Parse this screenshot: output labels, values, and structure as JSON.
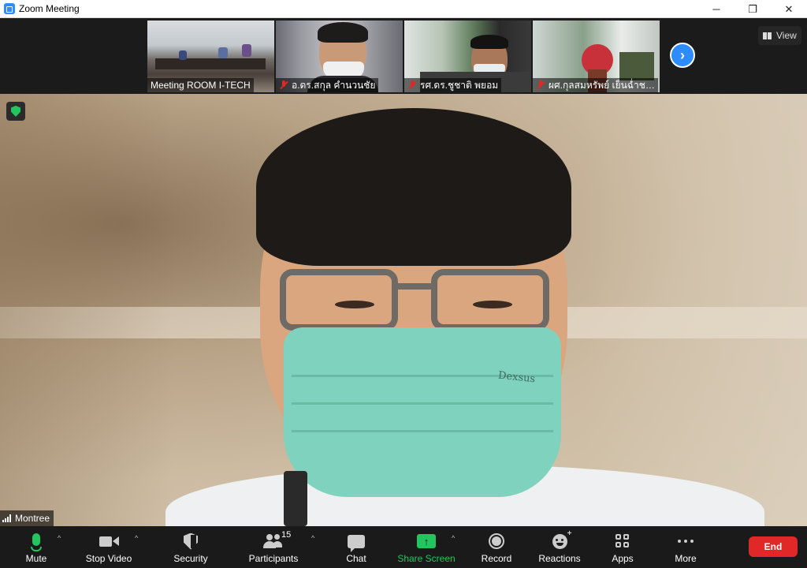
{
  "window": {
    "title": "Zoom Meeting",
    "minimize_glyph": "─",
    "maximize_glyph": "❐",
    "close_glyph": "✕"
  },
  "thumbnails": [
    {
      "label": "Meeting ROOM I-TECH",
      "muted": false
    },
    {
      "label": "อ.ดร.สกุล  คำนวนชัย",
      "muted": true
    },
    {
      "label": "รศ.ดร.ชูชาติ  พยอม",
      "muted": true
    },
    {
      "label": "ผศ.กุลสมหรัพย์  เย็นฉ่ำช…",
      "muted": true
    }
  ],
  "strip": {
    "next_glyph": "›",
    "view_label": "View"
  },
  "main_video": {
    "participant_name": "Montree",
    "mask_text": "Dexsus"
  },
  "toolbar": {
    "mute_label": "Mute",
    "stop_video_label": "Stop Video",
    "security_label": "Security",
    "participants_label": "Participants",
    "participants_count": "15",
    "chat_label": "Chat",
    "share_screen_label": "Share Screen",
    "share_glyph": "↑",
    "record_label": "Record",
    "reactions_label": "Reactions",
    "apps_label": "Apps",
    "more_label": "More",
    "end_label": "End",
    "caret_glyph": "^"
  },
  "colors": {
    "accent": "#2d8cff",
    "active_green": "#22c55e",
    "end_red": "#e02828",
    "toolbar_bg": "#1a1a1a"
  }
}
